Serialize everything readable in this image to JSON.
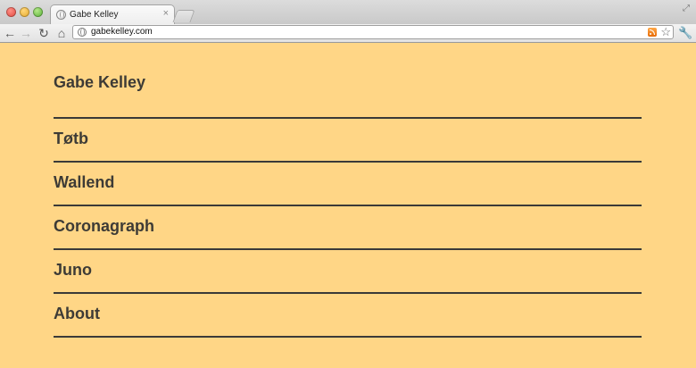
{
  "browser": {
    "tab_title": "Gabe Kelley",
    "tab_close": "×",
    "url": "gabekelley.com",
    "icons": {
      "back": "arrow-left-icon",
      "forward": "arrow-right-icon",
      "reload": "reload-icon",
      "home": "home-icon",
      "rss": "rss-icon",
      "star": "star-icon",
      "wrench": "wrench-icon"
    }
  },
  "site": {
    "title": "Gabe Kelley",
    "nav": [
      {
        "label": "Tøtb"
      },
      {
        "label": "Wallend"
      },
      {
        "label": "Coronagraph"
      },
      {
        "label": "Juno"
      },
      {
        "label": "About"
      }
    ]
  },
  "colors": {
    "background": "#ffd686",
    "text": "#3d3b36",
    "rule": "#3a3a38"
  }
}
